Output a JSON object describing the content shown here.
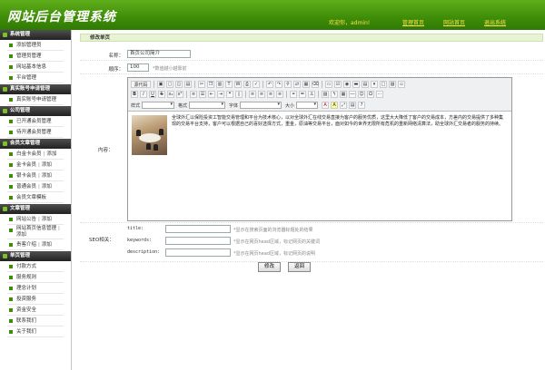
{
  "header": {
    "title": "网站后台管理系统",
    "welcome": "欢迎你，admin!",
    "nav": [
      "管理首页",
      "网站首页",
      "退出系统"
    ]
  },
  "sidebar": {
    "sections": [
      {
        "title": "系统管理",
        "items": [
          [
            "添加管理员"
          ],
          [
            "管理员管理"
          ],
          [
            "网站基本信息"
          ],
          [
            "平台管理"
          ]
        ]
      },
      {
        "title": "真实账号申请管理",
        "items": [
          [
            "真实账号申请管理"
          ]
        ]
      },
      {
        "title": "公司管理",
        "items": [
          [
            "已开通会员管理"
          ],
          [
            "待开通会员管理"
          ]
        ]
      },
      {
        "title": "会员文章管理",
        "items": [
          [
            "白金卡会员",
            "添加"
          ],
          [
            "金卡会员",
            "添加"
          ],
          [
            "银卡会员",
            "添加"
          ],
          [
            "普通会员",
            "添加"
          ],
          [
            "会员文章模板"
          ]
        ]
      },
      {
        "title": "文章管理",
        "items": [
          [
            "网站公告",
            "添加"
          ],
          [
            "网站首页信息管理",
            "添加"
          ],
          [
            "贵客介绍",
            "添加"
          ]
        ]
      },
      {
        "title": "单页管理",
        "items": [
          [
            "付款方式"
          ],
          [
            "服务规则"
          ],
          [
            "理念计划"
          ],
          [
            "投资服务"
          ],
          [
            "资金安全"
          ],
          [
            "联系我们"
          ],
          [
            "关于我们"
          ]
        ]
      }
    ]
  },
  "main": {
    "breadcrumb": "修改单页",
    "name_label": "名称：",
    "name_value": "首页公司简介",
    "order_label": "顺序：",
    "order_value": "100",
    "order_hint": "*数值越小越靠前",
    "content_label": "内容：",
    "toolbar": {
      "source": "源代码",
      "style_label": "样式",
      "format_label": "格式",
      "font_label": "字体",
      "size_label": "大小"
    },
    "article": "全球外汇以保险投资工智能交易管理和平台为技术核心，以对全球外汇在线交易直接为客户的服务优质，这里大大降低了客户的交易成本，方差内的交易提供了多种集现的交易平台支持，客户可以根据自己的喜好选择方式，重金，原油等交易平台，面对如今的世界无限所有危机的重新网络清算法，助全球外汇交易者的服务的持续。",
    "seo_label": "SEO相关：",
    "seo": [
      {
        "key": "title:",
        "hint": "*显示在搜索页面的浏览器标题处的结果"
      },
      {
        "key": "keywords:",
        "hint": "*显示在网页head区域，标记网页的关键词"
      },
      {
        "key": "description:",
        "hint": "*显示在网页head区域，标记网页的说明"
      }
    ],
    "submit": "修改",
    "back": "返回"
  },
  "colors": {
    "header_green": "#3f8c08",
    "header_text": "#ffe14a",
    "sidebar_head": "#2a2a2a",
    "crumb_bg": "#e8f3d6"
  }
}
